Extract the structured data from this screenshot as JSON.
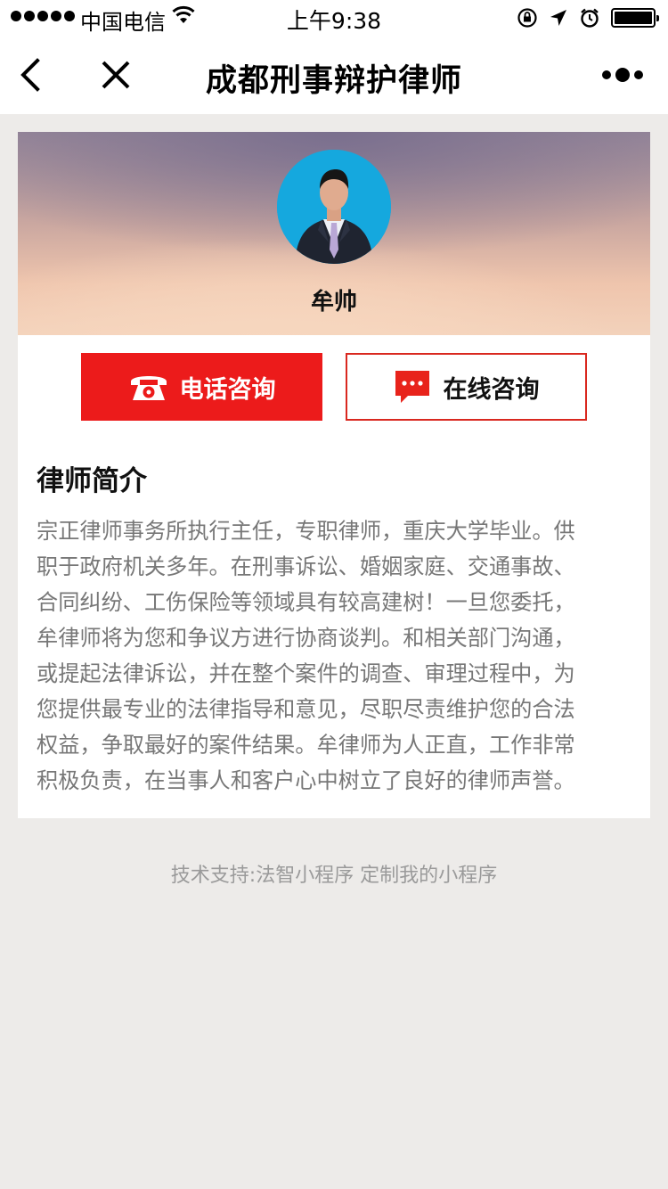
{
  "status_bar": {
    "carrier": "中国电信",
    "time": "上午9:38",
    "icons": [
      "signal-dots-icon",
      "wifi-icon",
      "rotation-lock-icon",
      "location-arrow-icon",
      "alarm-icon",
      "battery-icon"
    ]
  },
  "nav": {
    "title": "成都刑事辩护律师",
    "back_icon": "chevron-left-icon",
    "close_icon": "close-icon",
    "more_icon": "more-dots-icon"
  },
  "profile": {
    "name": "牟帅",
    "avatar_bg": "#15a8de"
  },
  "actions": {
    "phone_label": "电话咨询",
    "online_label": "在线咨询",
    "phone_color": "#ec1b1b",
    "online_border": "#d9281f"
  },
  "intro": {
    "title": "律师简介",
    "lines": [
      "宗正律师事务所执行主任，专职律师，重庆大学毕业。供",
      "职于政府机关多年。在刑事诉讼、婚姻家庭、交通事故、",
      "合同纠纷、工伤保险等领域具有较高建树！一旦您委托，",
      "牟律师将为您和争议方进行协商谈判。和相关部门沟通，",
      "或提起法律诉讼，并在整个案件的调查、审理过程中，为",
      "您提供最专业的法律指导和意见，尽职尽责维护您的合法",
      "权益，争取最好的案件结果。牟律师为人正直，工作非常",
      "积极负责，在当事人和客户心中树立了良好的律师声誉。"
    ]
  },
  "footer": {
    "text": "技术支持:法智小程序 定制我的小程序"
  }
}
